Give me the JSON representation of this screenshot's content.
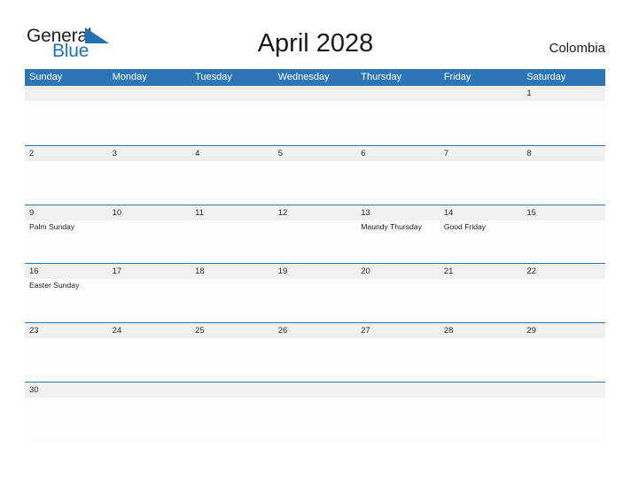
{
  "brand": {
    "name_top": "General",
    "name_bottom": "Blue",
    "accent_color": "#2271b3",
    "flag_icon": "blue-triangle-flag-icon"
  },
  "header": {
    "title": "April 2028",
    "country": "Colombia"
  },
  "colors": {
    "header_blue": "#2e75b6",
    "row_band_gray": "#f0f0f0",
    "cell_white": "#fdfdfd",
    "divider_blue": "#2e75b6",
    "text_dark": "#1a1a1a"
  },
  "calendar": {
    "weekdays": [
      "Sunday",
      "Monday",
      "Tuesday",
      "Wednesday",
      "Thursday",
      "Friday",
      "Saturday"
    ],
    "weeks": [
      {
        "days": [
          {
            "num": "",
            "events": []
          },
          {
            "num": "",
            "events": []
          },
          {
            "num": "",
            "events": []
          },
          {
            "num": "",
            "events": []
          },
          {
            "num": "",
            "events": []
          },
          {
            "num": "",
            "events": []
          },
          {
            "num": "1",
            "events": []
          }
        ]
      },
      {
        "days": [
          {
            "num": "2",
            "events": []
          },
          {
            "num": "3",
            "events": []
          },
          {
            "num": "4",
            "events": []
          },
          {
            "num": "5",
            "events": []
          },
          {
            "num": "6",
            "events": []
          },
          {
            "num": "7",
            "events": []
          },
          {
            "num": "8",
            "events": []
          }
        ]
      },
      {
        "days": [
          {
            "num": "9",
            "events": [
              "Palm Sunday"
            ]
          },
          {
            "num": "10",
            "events": []
          },
          {
            "num": "11",
            "events": []
          },
          {
            "num": "12",
            "events": []
          },
          {
            "num": "13",
            "events": [
              "Maundy Thursday"
            ]
          },
          {
            "num": "14",
            "events": [
              "Good Friday"
            ]
          },
          {
            "num": "15",
            "events": []
          }
        ]
      },
      {
        "days": [
          {
            "num": "16",
            "events": [
              "Easter Sunday"
            ]
          },
          {
            "num": "17",
            "events": []
          },
          {
            "num": "18",
            "events": []
          },
          {
            "num": "19",
            "events": []
          },
          {
            "num": "20",
            "events": []
          },
          {
            "num": "21",
            "events": []
          },
          {
            "num": "22",
            "events": []
          }
        ]
      },
      {
        "days": [
          {
            "num": "23",
            "events": []
          },
          {
            "num": "24",
            "events": []
          },
          {
            "num": "25",
            "events": []
          },
          {
            "num": "26",
            "events": []
          },
          {
            "num": "27",
            "events": []
          },
          {
            "num": "28",
            "events": []
          },
          {
            "num": "29",
            "events": []
          }
        ]
      },
      {
        "days": [
          {
            "num": "30",
            "events": []
          },
          {
            "num": "",
            "events": []
          },
          {
            "num": "",
            "events": []
          },
          {
            "num": "",
            "events": []
          },
          {
            "num": "",
            "events": []
          },
          {
            "num": "",
            "events": []
          },
          {
            "num": "",
            "events": []
          }
        ]
      }
    ]
  }
}
